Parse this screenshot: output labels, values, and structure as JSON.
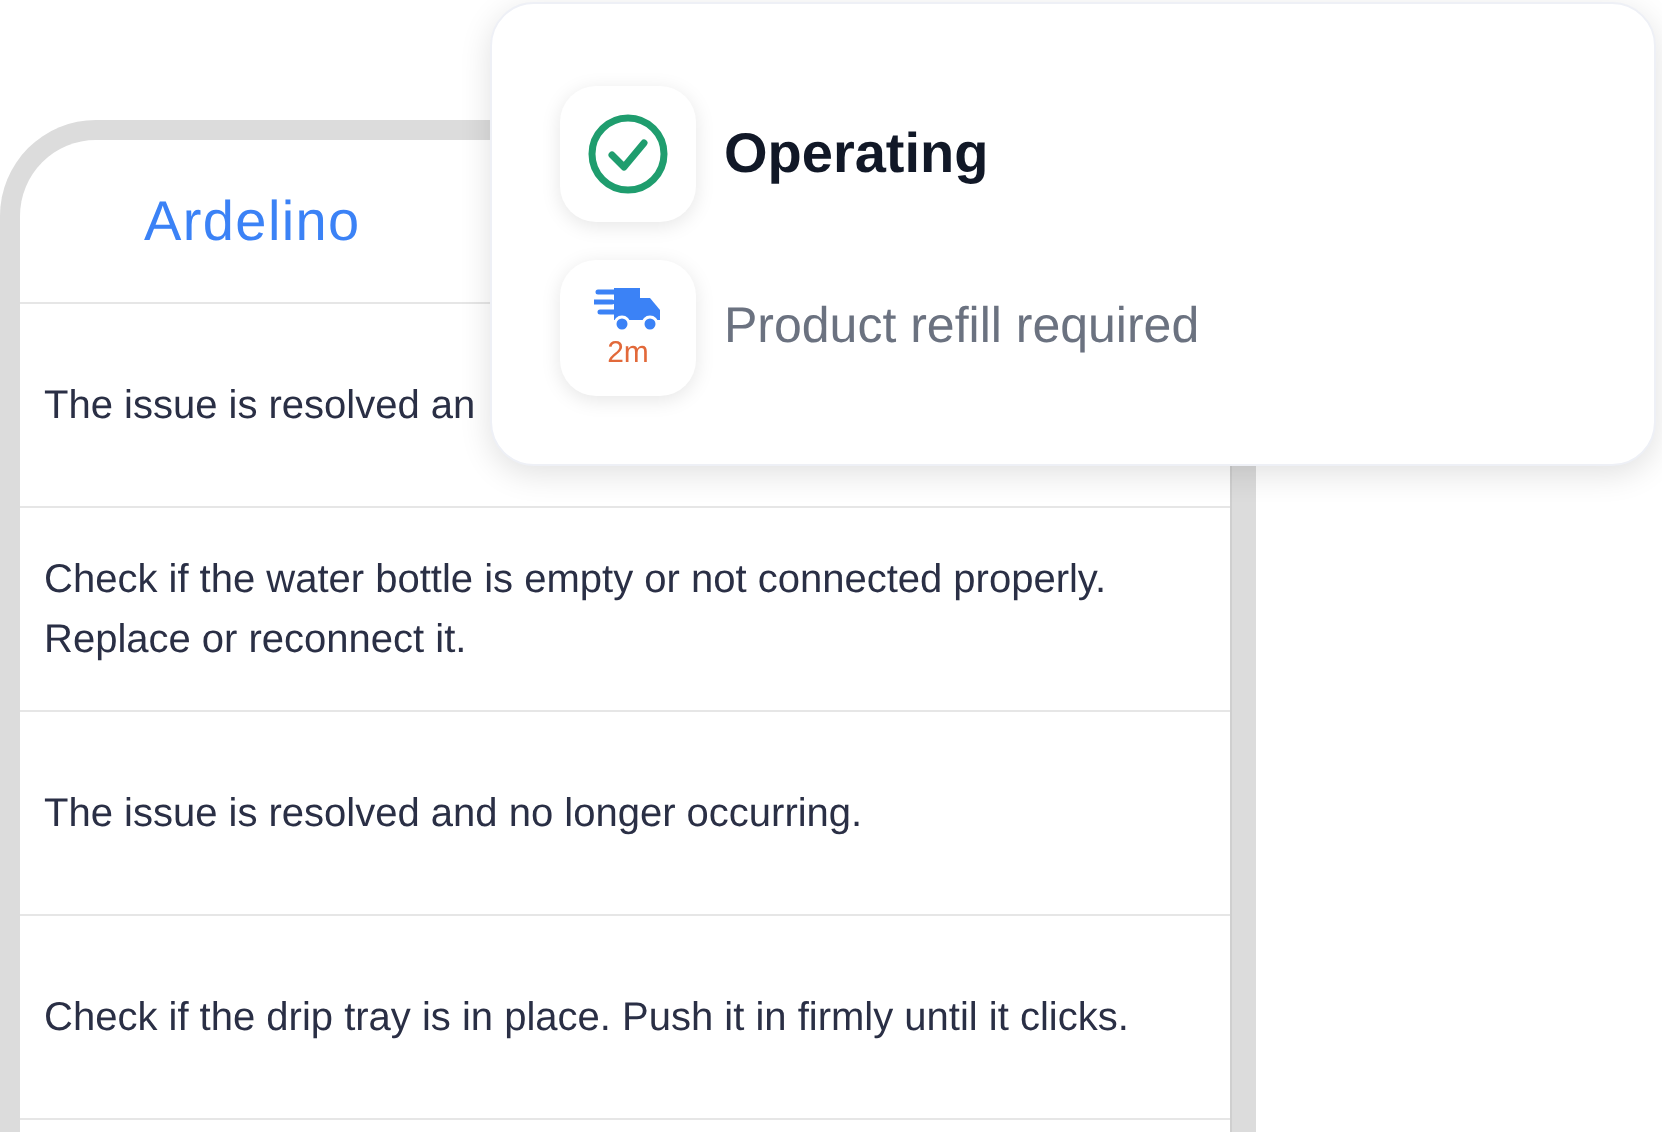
{
  "app": {
    "title": "Ardelino"
  },
  "messages": [
    {
      "text": "The issue is resolved an"
    },
    {
      "text": "Check if the water bottle is empty or not connected properly. Replace or reconnect it."
    },
    {
      "text": "The issue is resolved and no longer occurring."
    },
    {
      "text": "Check if the drip tray is in place. Push it in firmly until it clicks."
    }
  ],
  "status_card": {
    "status": {
      "kind": "ok",
      "label": "Operating"
    },
    "alert": {
      "kind": "delivery",
      "time": "2m",
      "label": "Product refill required"
    }
  }
}
